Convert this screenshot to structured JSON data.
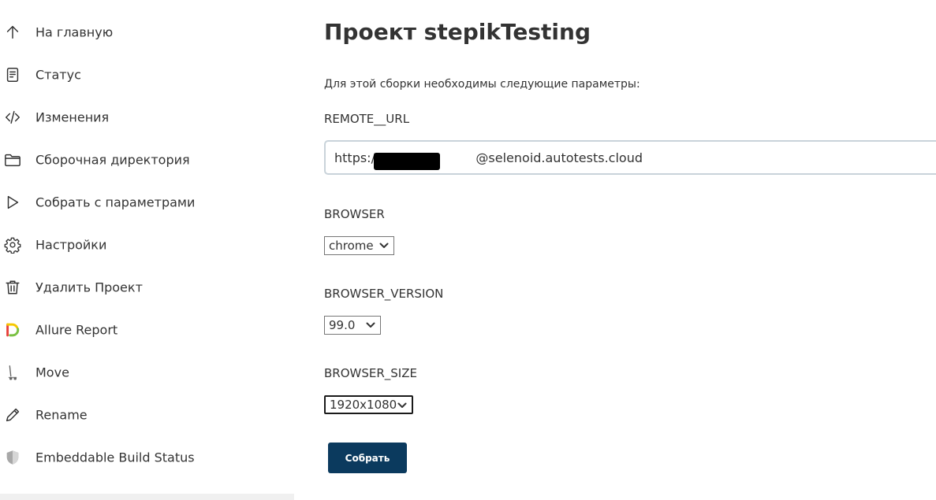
{
  "sidebar": {
    "items": [
      {
        "label": "На главную",
        "icon": "arrow-up-icon"
      },
      {
        "label": "Статус",
        "icon": "document-icon"
      },
      {
        "label": "Изменения",
        "icon": "code-icon"
      },
      {
        "label": "Сборочная директория",
        "icon": "folder-icon"
      },
      {
        "label": "Собрать с параметрами",
        "icon": "play-icon"
      },
      {
        "label": "Настройки",
        "icon": "gear-icon"
      },
      {
        "label": "Удалить Проект",
        "icon": "trash-icon"
      },
      {
        "label": "Allure Report",
        "icon": "allure-logo-icon"
      },
      {
        "label": "Move",
        "icon": "move-icon"
      },
      {
        "label": "Rename",
        "icon": "pencil-icon"
      },
      {
        "label": "Embeddable Build Status",
        "icon": "shield-icon"
      }
    ]
  },
  "main": {
    "title": "Проект stepikTesting",
    "description": "Для этой сборки необходимы следующие параметры:",
    "params": {
      "remote_url": {
        "label": "REMOTE__URL",
        "value": "https://                        @selenoid.autotests.cloud"
      },
      "browser": {
        "label": "BROWSER",
        "value": "chrome"
      },
      "browser_version": {
        "label": "BROWSER_VERSION",
        "value": "99.0"
      },
      "browser_size": {
        "label": "BROWSER_SIZE",
        "value": "1920x1080"
      }
    },
    "submit_label": "Собрать"
  },
  "colors": {
    "text": "#333333",
    "button": "#0b3a5e",
    "input_border": "#c9d3da",
    "allure_red": "#e8413c",
    "allure_yellow": "#f6c800",
    "allure_green": "#7ac143"
  }
}
